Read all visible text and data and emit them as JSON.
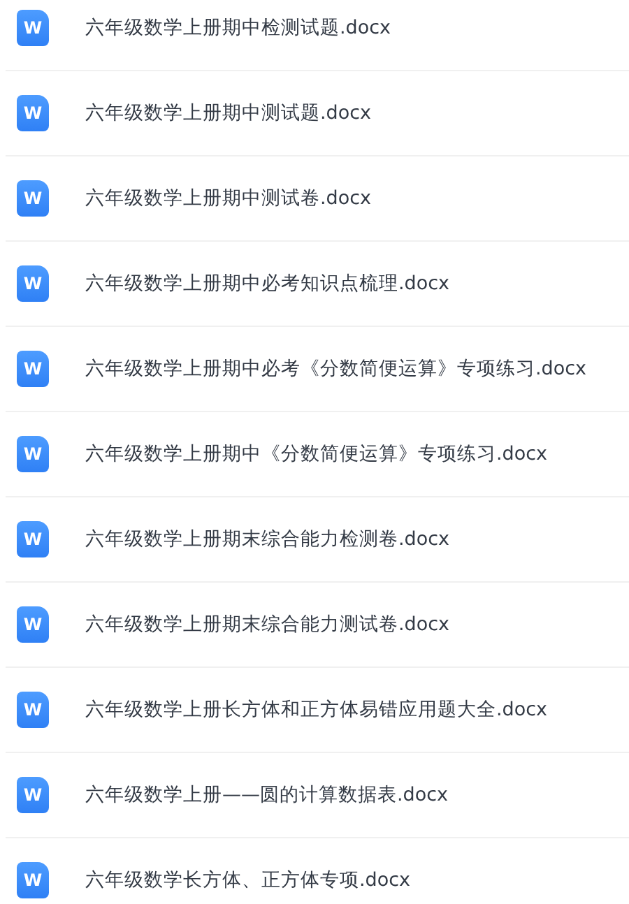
{
  "files": [
    {
      "icon_letter": "W",
      "name": "六年级数学上册期中检测试题.docx"
    },
    {
      "icon_letter": "W",
      "name": "六年级数学上册期中测试题.docx"
    },
    {
      "icon_letter": "W",
      "name": "六年级数学上册期中测试卷.docx"
    },
    {
      "icon_letter": "W",
      "name": "六年级数学上册期中必考知识点梳理.docx"
    },
    {
      "icon_letter": "W",
      "name": "六年级数学上册期中必考《分数简便运算》专项练习.docx"
    },
    {
      "icon_letter": "W",
      "name": "六年级数学上册期中《分数简便运算》专项练习.docx"
    },
    {
      "icon_letter": "W",
      "name": "六年级数学上册期末综合能力检测卷.docx"
    },
    {
      "icon_letter": "W",
      "name": "六年级数学上册期末综合能力测试卷.docx"
    },
    {
      "icon_letter": "W",
      "name": "六年级数学上册长方体和正方体易错应用题大全.docx"
    },
    {
      "icon_letter": "W",
      "name": "六年级数学上册——圆的计算数据表.docx"
    },
    {
      "icon_letter": "W",
      "name": "六年级数学长方体、正方体专项.docx"
    }
  ]
}
